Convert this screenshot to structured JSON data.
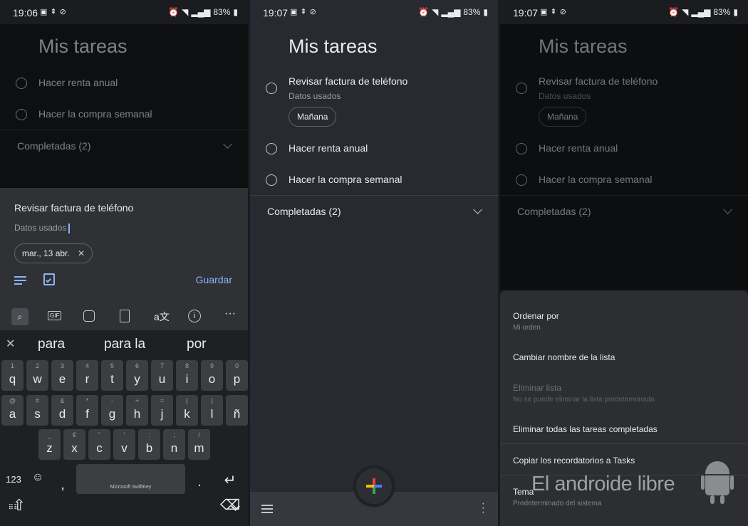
{
  "panel1": {
    "status": {
      "time": "19:06",
      "battery": "83%"
    },
    "title": "Mis tareas",
    "tasks": [
      {
        "label": "Hacer renta anual"
      },
      {
        "label": "Hacer la compra semanal"
      }
    ],
    "completed": "Completadas (2)",
    "editor": {
      "title_value": "Revisar factura de teléfono",
      "details_value": "Datos usados",
      "date_chip": "mar., 13 abr.",
      "save_label": "Guardar"
    },
    "keyboard": {
      "suggestions": [
        "para",
        "para la",
        "por"
      ],
      "row1": [
        [
          "q",
          "1"
        ],
        [
          "w",
          "2"
        ],
        [
          "e",
          "3"
        ],
        [
          "r",
          "4"
        ],
        [
          "t",
          "5"
        ],
        [
          "y",
          "6"
        ],
        [
          "u",
          "7"
        ],
        [
          "i",
          "8"
        ],
        [
          "o",
          "9"
        ],
        [
          "p",
          "0"
        ]
      ],
      "row2": [
        [
          "a",
          "@"
        ],
        [
          "s",
          "#"
        ],
        [
          "d",
          "&"
        ],
        [
          "f",
          "*"
        ],
        [
          "g",
          "-"
        ],
        [
          "h",
          "+"
        ],
        [
          "j",
          "="
        ],
        [
          "k",
          "("
        ],
        [
          "l",
          ")"
        ],
        [
          "ñ",
          ""
        ]
      ],
      "row3": [
        [
          "z",
          "_"
        ],
        [
          "x",
          "€"
        ],
        [
          "c",
          "\""
        ],
        [
          "v",
          "'"
        ],
        [
          "b",
          ":"
        ],
        [
          "n",
          ";"
        ],
        [
          "m",
          "/"
        ]
      ],
      "num_key": "123",
      "comma": ",",
      "period": ".",
      "space_label": "Microsoft SwiftKey"
    }
  },
  "panel2": {
    "status": {
      "time": "19:07",
      "battery": "83%"
    },
    "title": "Mis tareas",
    "tasks": [
      {
        "label": "Revisar factura de teléfono",
        "details": "Datos usados",
        "chip": "Mañana"
      },
      {
        "label": "Hacer renta anual"
      },
      {
        "label": "Hacer la compra semanal"
      }
    ],
    "completed": "Completadas (2)"
  },
  "panel3": {
    "status": {
      "time": "19:07",
      "battery": "83%"
    },
    "title": "Mis tareas",
    "tasks": [
      {
        "label": "Revisar factura de teléfono",
        "details": "Datos usados",
        "chip": "Mañana"
      },
      {
        "label": "Hacer renta anual"
      },
      {
        "label": "Hacer la compra semanal"
      }
    ],
    "completed": "Completadas (2)",
    "menu": [
      {
        "label": "Ordenar por",
        "sub": "Mi orden"
      },
      {
        "label": "Cambiar nombre de la lista"
      },
      {
        "label": "Eliminar lista",
        "sub": "No se puede eliminar la lista predeterminada"
      },
      {
        "label": "Eliminar todas las tareas completadas"
      },
      {
        "label": "Copiar los recordatorios a Tasks"
      },
      {
        "label": "Tema",
        "sub": "Predeterminado del sistema"
      }
    ],
    "watermark": "El androide libre"
  },
  "colors": {
    "accent": "#8ab4f8",
    "fab_red": "#ea4335",
    "fab_blue": "#4285f4",
    "fab_yellow": "#fbbc04",
    "fab_green": "#34a853"
  }
}
